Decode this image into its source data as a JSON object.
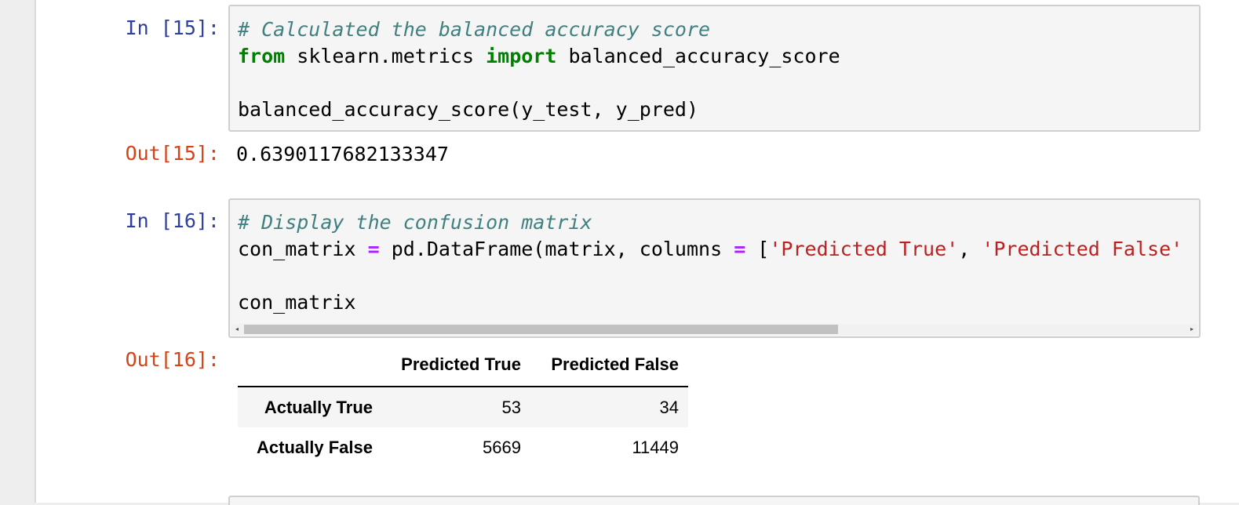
{
  "cells": [
    {
      "in_prompt": "In [15]:",
      "code": {
        "comment": "# Calculated the balanced accuracy score",
        "line2_kw1": "from",
        "line2_mod": " sklearn.metrics ",
        "line2_kw2": "import",
        "line2_name": " balanced_accuracy_score",
        "line4": "balanced_accuracy_score(y_test, y_pred)"
      },
      "out_prompt": "Out[15]:",
      "output": "0.6390117682133347"
    },
    {
      "in_prompt": "In [16]:",
      "code": {
        "comment": "# Display the confusion matrix",
        "line2_a": "con_matrix ",
        "line2_op1": "=",
        "line2_b": " pd.DataFrame(matrix, columns ",
        "line2_op2": "=",
        "line2_c": " [",
        "line2_str1": "'Predicted True'",
        "line2_d": ", ",
        "line2_str2": "'Predicted False'",
        "line4": "con_matrix"
      },
      "out_prompt": "Out[16]:",
      "dataframe": {
        "columns": [
          "Predicted True",
          "Predicted False"
        ],
        "rows": [
          {
            "index": "Actually True",
            "values": [
              "53",
              "34"
            ]
          },
          {
            "index": "Actually False",
            "values": [
              "5669",
              "11449"
            ]
          }
        ]
      }
    }
  ],
  "scrollbar": {
    "left_arrow": "◂",
    "right_arrow": "▸"
  }
}
